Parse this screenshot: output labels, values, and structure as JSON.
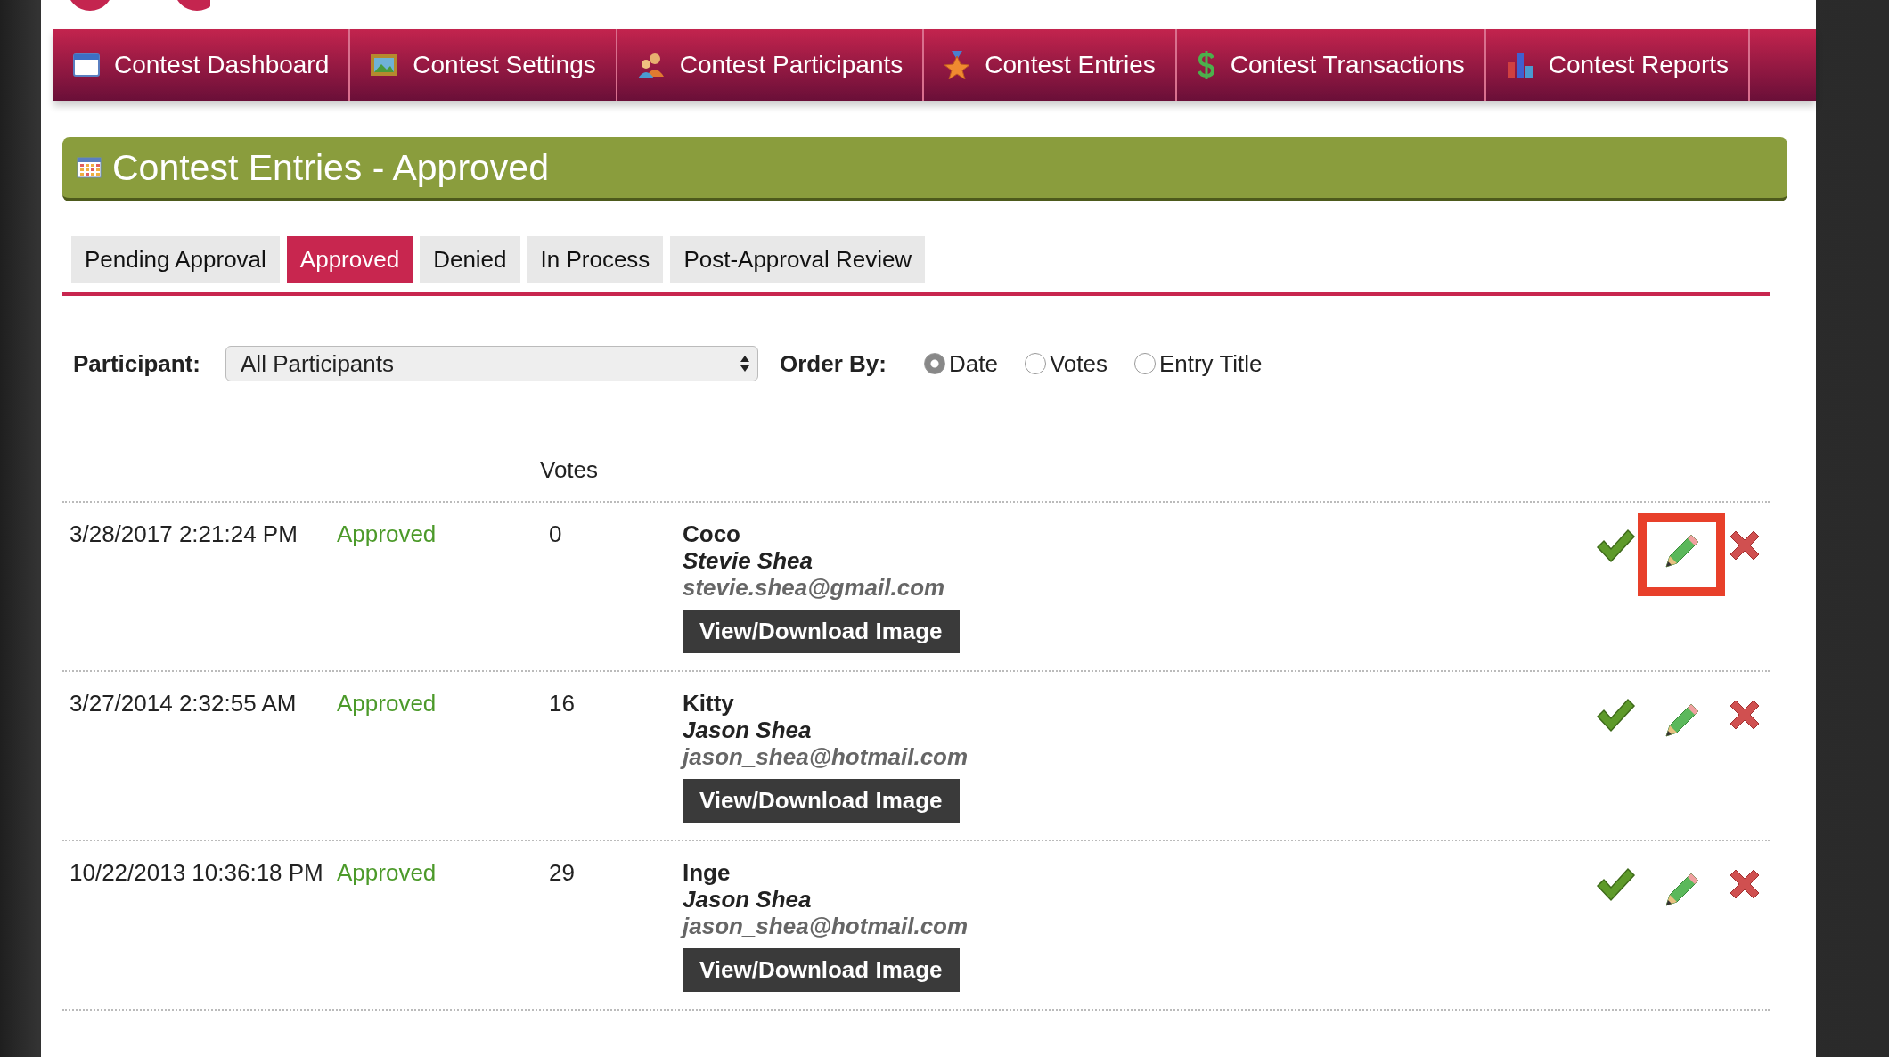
{
  "nav": [
    {
      "label": "Contest Dashboard"
    },
    {
      "label": "Contest Settings"
    },
    {
      "label": "Contest Participants"
    },
    {
      "label": "Contest Entries"
    },
    {
      "label": "Contest Transactions"
    },
    {
      "label": "Contest Reports"
    }
  ],
  "page_title": "Contest Entries - Approved",
  "tabs": [
    {
      "label": "Pending Approval",
      "selected": false
    },
    {
      "label": "Approved",
      "selected": true
    },
    {
      "label": "Denied",
      "selected": false
    },
    {
      "label": "In Process",
      "selected": false
    },
    {
      "label": "Post-Approval Review",
      "selected": false
    }
  ],
  "filter": {
    "participant_label": "Participant:",
    "participant_value": "All Participants",
    "order_label": "Order By:",
    "order_options": [
      {
        "label": "Date",
        "selected": true
      },
      {
        "label": "Votes",
        "selected": false
      },
      {
        "label": "Entry Title",
        "selected": false
      }
    ]
  },
  "table": {
    "votes_header": "Votes",
    "rows": [
      {
        "date": "3/28/2017 2:21:24 PM",
        "status": "Approved",
        "votes": "0",
        "title": "Coco",
        "name": "Stevie Shea",
        "email": "stevie.shea@gmail.com",
        "button": "View/Download Image",
        "edit_highlighted": true
      },
      {
        "date": "3/27/2014 2:32:55 AM",
        "status": "Approved",
        "votes": "16",
        "title": "Kitty",
        "name": "Jason Shea",
        "email": "jason_shea@hotmail.com",
        "button": "View/Download Image",
        "edit_highlighted": false
      },
      {
        "date": "10/22/2013 10:36:18 PM",
        "status": "Approved",
        "votes": "29",
        "title": "Inge",
        "name": "Jason Shea",
        "email": "jason_shea@hotmail.com",
        "button": "View/Download Image",
        "edit_highlighted": false
      }
    ]
  }
}
